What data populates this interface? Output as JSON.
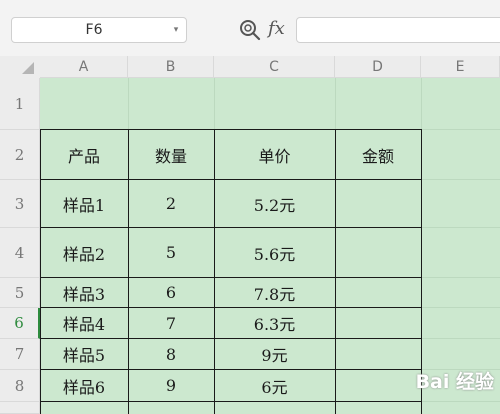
{
  "formula_bar": {
    "namebox_value": "F6",
    "fx_label": "fx",
    "formula_value": ""
  },
  "columns": [
    "A",
    "B",
    "C",
    "D",
    "E"
  ],
  "rows": [
    "1",
    "2",
    "3",
    "4",
    "5",
    "6",
    "7",
    "8"
  ],
  "active_row": "6",
  "table": {
    "headers": [
      "产品",
      "数量",
      "单价",
      "金额"
    ],
    "data": [
      [
        "样品1",
        "2",
        "5.2元",
        ""
      ],
      [
        "样品2",
        "5",
        "5.6元",
        ""
      ],
      [
        "样品3",
        "6",
        "7.8元",
        ""
      ],
      [
        "样品4",
        "7",
        "6.3元",
        ""
      ],
      [
        "样品5",
        "8",
        "9元",
        ""
      ],
      [
        "样品6",
        "9",
        "6元",
        ""
      ]
    ]
  },
  "watermark": "Bai 经验",
  "colors": {
    "sheet_bg": "#cce8cf",
    "active_row_header": "#2e8b3e"
  },
  "icons": [
    "zoom-formula-icon",
    "dropdown-arrow-icon"
  ]
}
